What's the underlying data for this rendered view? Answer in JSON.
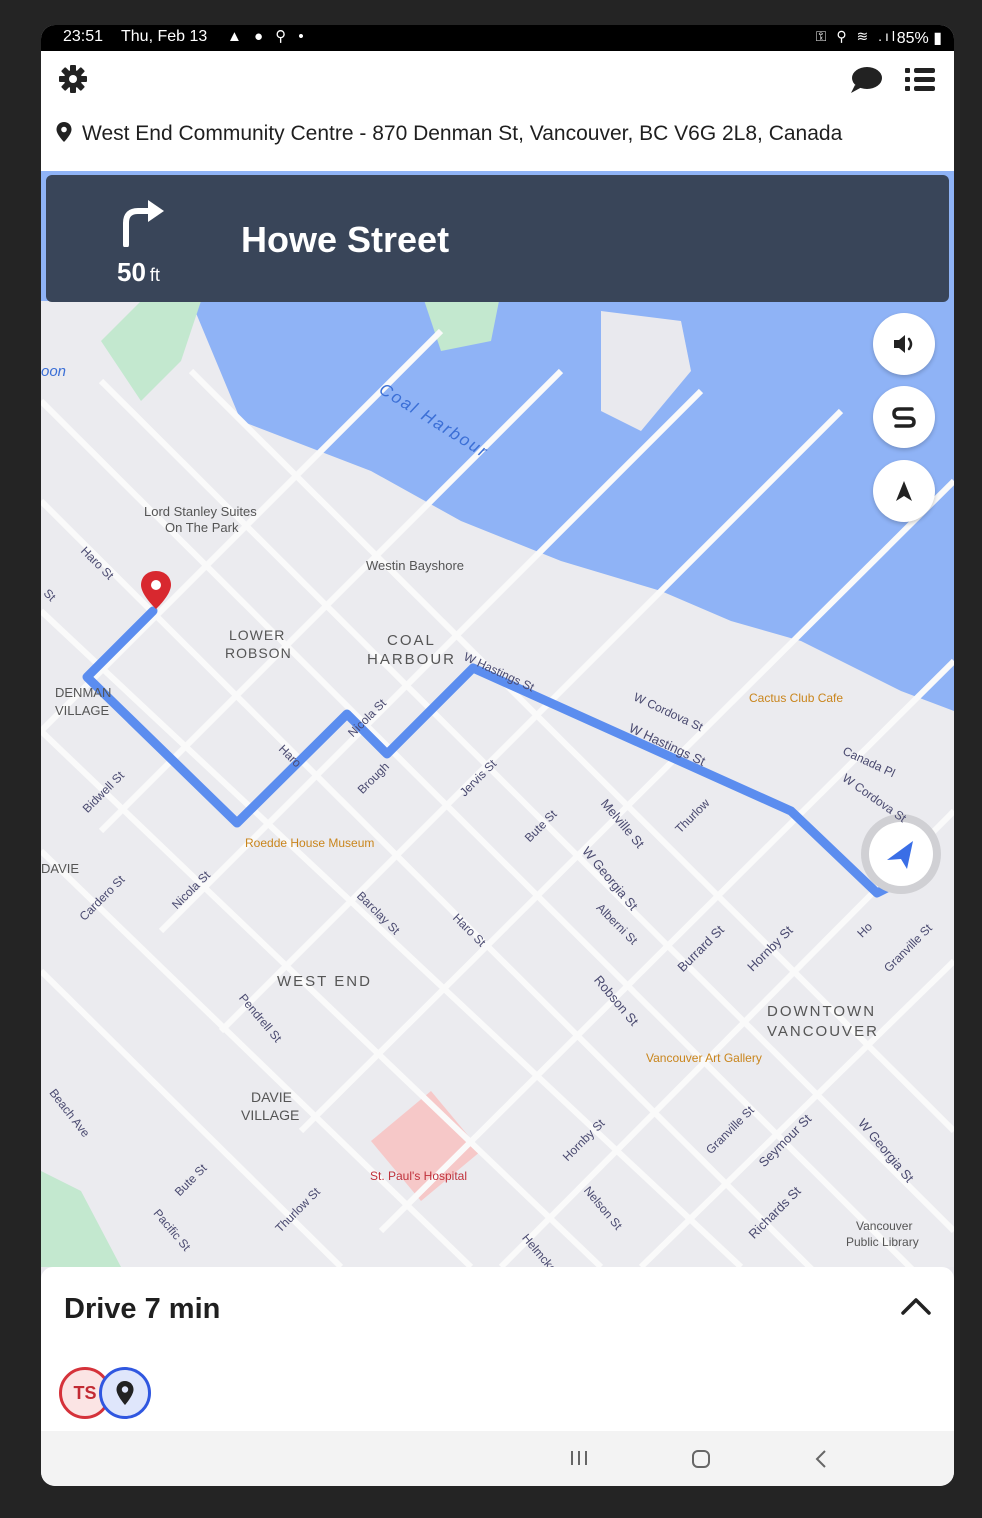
{
  "status_bar": {
    "time": "23:51",
    "date": "Thu, Feb 13",
    "left_icons": "▲ ● ⚲ •",
    "right_icons": "⚿ ⚲ ≋ .ıl",
    "battery": "85%"
  },
  "header": {
    "destination": "West End Community Centre - 870 Denman St, Vancouver, BC V6G 2L8, Canada"
  },
  "turn_instruction": {
    "direction": "turn-right",
    "distance_value": "50",
    "distance_unit": "ft",
    "street": "Howe Street"
  },
  "map": {
    "labels": {
      "pier_partial": "oon",
      "coal_harbour_water": "Coal Harbour",
      "lord_stanley_1": "Lord Stanley Suites",
      "lord_stanley_2": "On The Park",
      "westin": "Westin Bayshore",
      "lower_robson_1": "LOWER",
      "lower_robson_2": "ROBSON",
      "coal_harbour_1": "COAL",
      "coal_harbour_2": "HARBOUR",
      "denman_village_1": "DENMAN",
      "denman_village_2": "VILLAGE",
      "davie": "DAVIE",
      "west_end": "WEST END",
      "davie_village_1": "DAVIE",
      "davie_village_2": "VILLAGE",
      "downtown_1": "DOWNTOWN",
      "downtown_2": "VANCOUVER",
      "cactus": "Cactus Club Cafe",
      "roedde": "Roedde House Museum",
      "art_gallery": "Vancouver Art Gallery",
      "st_pauls": "St. Paul's Hospital",
      "library_1": "Vancouver",
      "library_2": "Public Library"
    },
    "streets": {
      "haro1": "Haro St",
      "st1": "St",
      "w_hastings1": "W Hastings St",
      "w_cordova1": "W Cordova St",
      "w_hastings2": "W Hastings St",
      "canada_pl": "Canada Pl",
      "w_cordova2": "W Cordova St",
      "nicola1": "Nicola St",
      "haro2": "Haro",
      "broughton": "Brough",
      "jervis": "Jervis St",
      "bidwell": "Bidwell St",
      "bute1": "Bute St",
      "melville": "Melville St",
      "thurlow1": "Thurlow",
      "w_georgia1": "W Georgia St",
      "alberni": "Alberni St",
      "cardero": "Cardero St",
      "nicola2": "Nicola St",
      "barclay": "Barclay St",
      "haro3": "Haro St",
      "burrard": "Burrard St",
      "hornby1": "Hornby St",
      "granville1": "Granville St",
      "howe": "Ho",
      "robson": "Robson St",
      "pendrell": "Pendrell St",
      "beach": "Beach Ave",
      "hornby2": "Hornby St",
      "granville2": "Granville St",
      "seymour": "Seymour St",
      "w_georgia2": "W Georgia St",
      "bute2": "Bute St",
      "pacific": "Pacific St",
      "thurlow2": "Thurlow St",
      "nelson": "Nelson St",
      "richards": "Richards St",
      "helmcken": "Helmcken"
    }
  },
  "map_controls": {
    "sound_icon": "volume-icon",
    "route_icon": "route-overview-icon",
    "compass_icon": "north-arrow-icon"
  },
  "bottom_sheet": {
    "title": "Drive 7 min",
    "badge_initials": "TS"
  },
  "colors": {
    "banner_bg": "#394559",
    "route": "#5b8def",
    "water": "#8fb3f6",
    "park": "#c3e8cf",
    "destination_pin": "#d8282f"
  }
}
